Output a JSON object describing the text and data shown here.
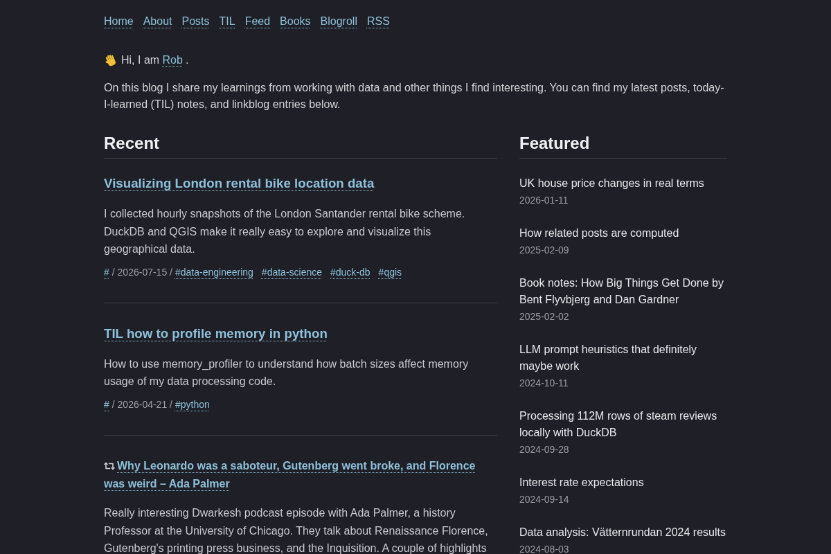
{
  "nav": [
    "Home",
    "About",
    "Posts",
    "TIL",
    "Feed",
    "Books",
    "Blogroll",
    "RSS"
  ],
  "intro": {
    "greeting": "Hi, I am",
    "name": "Rob",
    "suffix": ".",
    "text": "On this blog I share my learnings from working with data and other things I find interesting. You can find my latest posts, today-I-learned (TIL) notes, and linkblog entries below."
  },
  "recent": {
    "heading": "Recent",
    "posts": [
      {
        "kind": "post",
        "title": "Visualizing London rental bike location data",
        "summary": "I collected hourly snapshots of the London Santander rental bike scheme. DuckDB and QGIS make it really easy to explore and visualize this geographical data.",
        "meta": [
          {
            "kind": "link",
            "text": "#"
          },
          {
            "kind": "text",
            "text": "/ 2026-07-15 /"
          },
          {
            "kind": "tag",
            "text": "#data-engineering"
          },
          {
            "kind": "tag",
            "text": "#data-science"
          },
          {
            "kind": "tag",
            "text": "#duck-db"
          },
          {
            "kind": "tag",
            "text": "#qgis"
          }
        ]
      },
      {
        "kind": "post",
        "title": "TIL how to profile memory in python",
        "summary": "How to use memory_profiler to understand how batch sizes affect memory usage of my data processing code.",
        "meta": [
          {
            "kind": "link",
            "text": "#"
          },
          {
            "kind": "text",
            "text": "/ 2026-04-21 /"
          },
          {
            "kind": "tag",
            "text": "#python"
          }
        ]
      },
      {
        "kind": "link",
        "title": "Why Leonardo was a saboteur, Gutenberg went broke, and Florence was weird – Ada Palmer",
        "summary": "Really interesting Dwarkesh podcast episode with Ada Palmer, a history Professor at the University of Chicago. They talk about Renaissance Florence, Gutenberg's printing press business, and the Inquisition. A couple of highlights"
      }
    ]
  },
  "featured": {
    "heading": "Featured",
    "items": [
      {
        "title": "UK house price changes in real terms",
        "date": "2026-01-11"
      },
      {
        "title": "How related posts are computed",
        "date": "2025-02-09"
      },
      {
        "title": "Book notes: How Big Things Get Done by Bent Flyvbjerg and Dan Gardner",
        "date": "2025-02-02"
      },
      {
        "title": "LLM prompt heuristics that definitely maybe work",
        "date": "2024-10-11"
      },
      {
        "title": "Processing 112M rows of steam reviews locally with DuckDB",
        "date": "2024-09-28"
      },
      {
        "title": "Interest rate expectations",
        "date": "2024-09-14"
      },
      {
        "title": "Data analysis: Vätternrundan 2024 results",
        "date": "2024-08-03"
      }
    ]
  }
}
